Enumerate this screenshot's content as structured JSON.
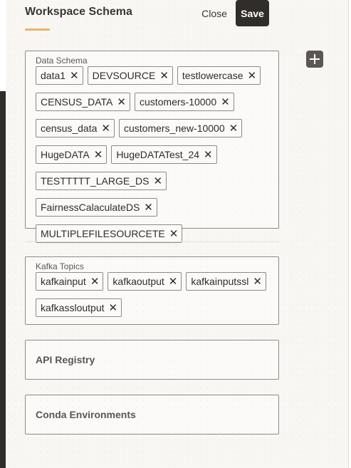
{
  "header": {
    "title": "Workspace Schema",
    "close_label": "Close",
    "save_label": "Save"
  },
  "add_button": {
    "icon": "plus-icon"
  },
  "data_schema": {
    "label": "Data Schema",
    "chips": [
      "data1",
      "DEVSOURCE",
      "testlowercase",
      "CENSUS_DATA",
      "customers-10000",
      "census_data",
      "customers_new-10000",
      "HugeDATA",
      "HugeDATATest_24",
      "TESTTTTT_LARGE_DS",
      "FairnessCalaculateDS",
      "MULTIPLEFILESOURCETE"
    ]
  },
  "kafka_topics": {
    "label": "Kafka Topics",
    "chips": [
      "kafkainput",
      "kafkaoutput",
      "kafkainputssl",
      "kafkassloutput"
    ]
  },
  "api_registry": {
    "title": "API Registry"
  },
  "conda_environments": {
    "title": "Conda Environments"
  },
  "chip_remove_glyph": "✕",
  "colors": {
    "accent": "#e8b46a",
    "primary_button": "#312d2a",
    "add_button": "#5d5753",
    "border": "#8f8983"
  }
}
